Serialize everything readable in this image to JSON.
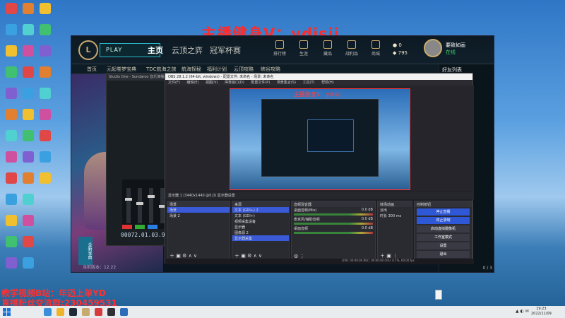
{
  "overlay": {
    "top_watermark": "主播健身V：ydjsjj",
    "bottom_line1": "教学视频B站：年迈上单YD",
    "bottom_line2": "直播粉丝交流群:230459531"
  },
  "client": {
    "logo": "L",
    "play_label": "PLAY",
    "tabs": [
      "主页",
      "云顶之弈",
      "冠军杯赛"
    ],
    "top_icons": [
      "排行榜",
      "生涯",
      "藏品",
      "战利品",
      "商城"
    ],
    "currency_1": "0",
    "currency_2": "795",
    "player_name": "要致如画",
    "player_status": "在线",
    "subnav": [
      "首页",
      "元起卷梦宝典",
      "TDC航海之旅",
      "航海探秘",
      "福利计划",
      "云顶攻略",
      "峡谷攻略"
    ],
    "banner_text": "全新宝典",
    "version": "当前版本：12.22",
    "friends_title": "好友列表",
    "friends_count": "0 / 3"
  },
  "recorder": {
    "title": "Studio One - Sundaroo 音乐演播厅",
    "timer": "00072.01.03.93"
  },
  "obs": {
    "title": "OBS 28.1.2 (64-bit, windows) - 配置文件: 未命名 - 场景: 未命名",
    "menu": [
      "文件(F)",
      "编辑(E)",
      "视图(V)",
      "停靠窗口(D)",
      "配置文件(P)",
      "场景集合(S)",
      "工具(T)",
      "帮助(H)"
    ],
    "preview_watermark": "主播健身V：ydjsjj",
    "source_bar": "显示器 1 (3440x1440 @0,0) 显示器设置",
    "docks": {
      "scenes_title": "场景",
      "scenes": [
        "场景",
        "场景 2"
      ],
      "sources_title": "来源",
      "sources": [
        "文本 (GDI+) 2",
        "文本 (GDI+)",
        "视频采集设备",
        "显示器",
        "图像源 2",
        "显示器采集"
      ],
      "mixer_title": "音频混音器",
      "mixer_channels": [
        {
          "name": "桌面音频(Mix)",
          "db": "0.0 dB"
        },
        {
          "name": "麦克风/辅助音频",
          "db": "0.0 dB"
        },
        {
          "name": "桌面音频",
          "db": "0.0 dB"
        }
      ],
      "transitions_title": "转场动画",
      "transition": "淡出",
      "duration_label": "时长",
      "duration": "300 ms",
      "controls_title": "控制按钮",
      "controls": [
        "停止直播",
        "停止录制",
        "启动虚拟摄像机",
        "工作室模式",
        "设置",
        "退出"
      ]
    },
    "status": "LIVE: 00:00:00   REC: 00:00:00   CPU: 0.7%, 60.00 fps"
  },
  "taskbar": {
    "time": "19:23",
    "date": "2022/11/09"
  },
  "colors": {
    "obs_selected": "#3a5ad8",
    "obs_control_blue": "#2f58d6",
    "watermark_red": "#ff2b2b"
  }
}
